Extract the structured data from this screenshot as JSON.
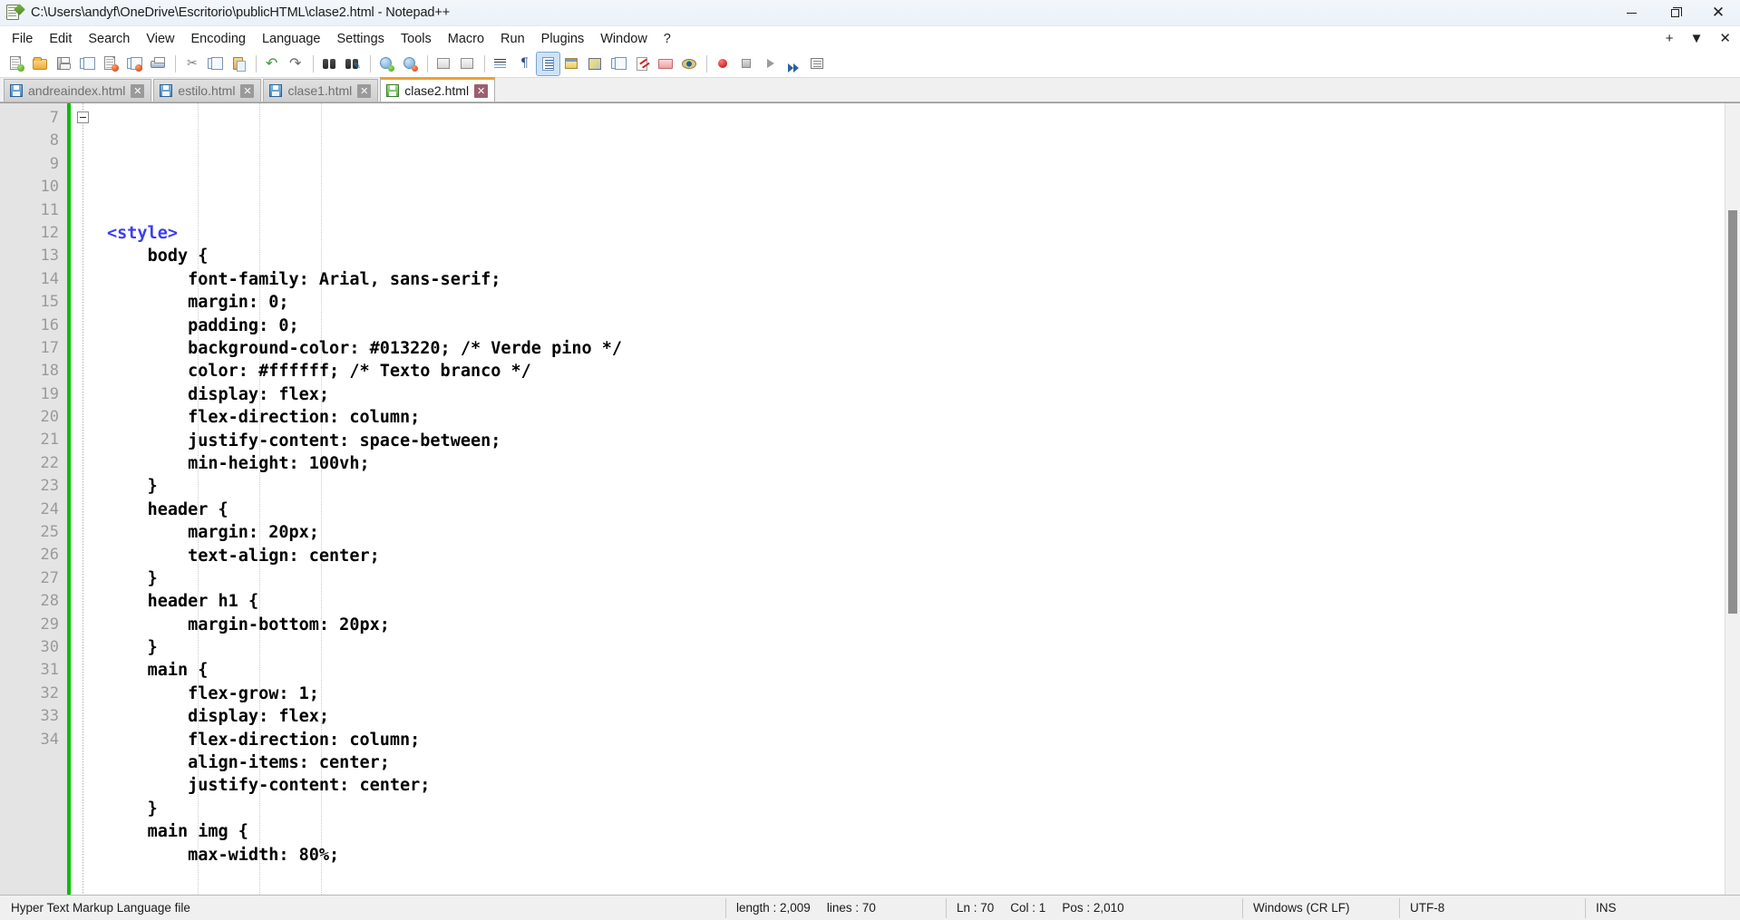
{
  "window": {
    "title": "C:\\Users\\andyf\\OneDrive\\Escritorio\\publicHTML\\clase2.html - Notepad++",
    "app_icon": "notepadpp-icon",
    "controls": {
      "minimize": "minimize-icon",
      "maximize": "restore-icon",
      "close": "close-icon"
    }
  },
  "menu": {
    "items": [
      "File",
      "Edit",
      "Search",
      "View",
      "Encoding",
      "Language",
      "Settings",
      "Tools",
      "Macro",
      "Run",
      "Plugins",
      "Window",
      "?"
    ],
    "right": {
      "plus": "+",
      "caret": "▼",
      "close": "✕"
    }
  },
  "toolbar": {
    "buttons": [
      "new-file-icon",
      "open-file-icon",
      "save-icon",
      "save-all-icon",
      "close-file-icon",
      "close-all-icon",
      "print-icon",
      "cut-icon",
      "copy-icon",
      "paste-icon",
      "undo-icon",
      "redo-icon",
      "find-icon",
      "replace-icon",
      "zoom-in-icon",
      "zoom-out-icon",
      "sync-vertical-scroll-icon",
      "sync-horizontal-scroll-icon",
      "word-wrap-icon",
      "show-all-characters-icon",
      "show-indent-guide-icon",
      "user-defined-dialog-icon",
      "document-map-icon",
      "function-list-icon",
      "document-list-icon",
      "folder-as-workspace-icon",
      "monitoring-icon",
      "record-macro-icon",
      "stop-recording-icon",
      "play-macro-icon",
      "run-macro-multiple-icon",
      "run-icon"
    ]
  },
  "tabs": [
    {
      "label": "andreaindex.html",
      "icon": "save-blue-icon",
      "active": false
    },
    {
      "label": "estilo.html",
      "icon": "save-blue-icon",
      "active": false
    },
    {
      "label": "clase1.html",
      "icon": "save-blue-icon",
      "active": false
    },
    {
      "label": "clase2.html",
      "icon": "save-green-icon",
      "active": true
    }
  ],
  "editor": {
    "first_line": 7,
    "fold_line": 7,
    "lines": [
      {
        "n": 7,
        "indent": 0,
        "parts": [
          {
            "t": "tag",
            "s": "<style>"
          }
        ]
      },
      {
        "n": 8,
        "indent": 1,
        "parts": [
          {
            "t": "code",
            "s": "body {"
          }
        ]
      },
      {
        "n": 9,
        "indent": 2,
        "parts": [
          {
            "t": "code",
            "s": "font-family: Arial, sans-serif;"
          }
        ]
      },
      {
        "n": 10,
        "indent": 2,
        "parts": [
          {
            "t": "code",
            "s": "margin: 0;"
          }
        ]
      },
      {
        "n": 11,
        "indent": 2,
        "parts": [
          {
            "t": "code",
            "s": "padding: 0;"
          }
        ]
      },
      {
        "n": 12,
        "indent": 2,
        "parts": [
          {
            "t": "code",
            "s": "background-color: #013220; /* Verde pino */"
          }
        ]
      },
      {
        "n": 13,
        "indent": 2,
        "parts": [
          {
            "t": "code",
            "s": "color: #ffffff; /* Texto branco */"
          }
        ]
      },
      {
        "n": 14,
        "indent": 2,
        "parts": [
          {
            "t": "code",
            "s": "display: flex;"
          }
        ]
      },
      {
        "n": 15,
        "indent": 2,
        "parts": [
          {
            "t": "code",
            "s": "flex-direction: column;"
          }
        ]
      },
      {
        "n": 16,
        "indent": 2,
        "parts": [
          {
            "t": "code",
            "s": "justify-content: space-between;"
          }
        ]
      },
      {
        "n": 17,
        "indent": 2,
        "parts": [
          {
            "t": "code",
            "s": "min-height: 100vh;"
          }
        ]
      },
      {
        "n": 18,
        "indent": 1,
        "parts": [
          {
            "t": "code",
            "s": "}"
          }
        ]
      },
      {
        "n": 19,
        "indent": 1,
        "parts": [
          {
            "t": "code",
            "s": "header {"
          }
        ]
      },
      {
        "n": 20,
        "indent": 2,
        "parts": [
          {
            "t": "code",
            "s": "margin: 20px;"
          }
        ]
      },
      {
        "n": 21,
        "indent": 2,
        "parts": [
          {
            "t": "code",
            "s": "text-align: center;"
          }
        ]
      },
      {
        "n": 22,
        "indent": 1,
        "parts": [
          {
            "t": "code",
            "s": "}"
          }
        ]
      },
      {
        "n": 23,
        "indent": 1,
        "parts": [
          {
            "t": "code",
            "s": "header h1 {"
          }
        ]
      },
      {
        "n": 24,
        "indent": 2,
        "parts": [
          {
            "t": "code",
            "s": "margin-bottom: 20px;"
          }
        ]
      },
      {
        "n": 25,
        "indent": 1,
        "parts": [
          {
            "t": "code",
            "s": "}"
          }
        ]
      },
      {
        "n": 26,
        "indent": 1,
        "parts": [
          {
            "t": "code",
            "s": "main {"
          }
        ]
      },
      {
        "n": 27,
        "indent": 2,
        "parts": [
          {
            "t": "code",
            "s": "flex-grow: 1;"
          }
        ]
      },
      {
        "n": 28,
        "indent": 2,
        "parts": [
          {
            "t": "code",
            "s": "display: flex;"
          }
        ]
      },
      {
        "n": 29,
        "indent": 2,
        "parts": [
          {
            "t": "code",
            "s": "flex-direction: column;"
          }
        ]
      },
      {
        "n": 30,
        "indent": 2,
        "parts": [
          {
            "t": "code",
            "s": "align-items: center;"
          }
        ]
      },
      {
        "n": 31,
        "indent": 2,
        "parts": [
          {
            "t": "code",
            "s": "justify-content: center;"
          }
        ]
      },
      {
        "n": 32,
        "indent": 1,
        "parts": [
          {
            "t": "code",
            "s": "}"
          }
        ]
      },
      {
        "n": 33,
        "indent": 1,
        "parts": [
          {
            "t": "code",
            "s": "main img {"
          }
        ]
      },
      {
        "n": 34,
        "indent": 2,
        "parts": [
          {
            "t": "code",
            "s": "max-width: 80%;"
          }
        ]
      }
    ]
  },
  "statusbar": {
    "doc_type": "Hyper Text Markup Language file",
    "length_label": "length : 2,009",
    "lines_label": "lines : 70",
    "ln": "Ln : 70",
    "col": "Col : 1",
    "pos": "Pos : 2,010",
    "eol": "Windows (CR LF)",
    "encoding": "UTF-8",
    "insert_mode": "INS"
  },
  "colors": {
    "tag": "#3d3df0",
    "code": "#000000",
    "modified_bar": "#00c000",
    "active_tab_accent": "#f0a030",
    "gutter_bg": "#e4e4e4",
    "gutter_text": "#9a9a9a"
  }
}
